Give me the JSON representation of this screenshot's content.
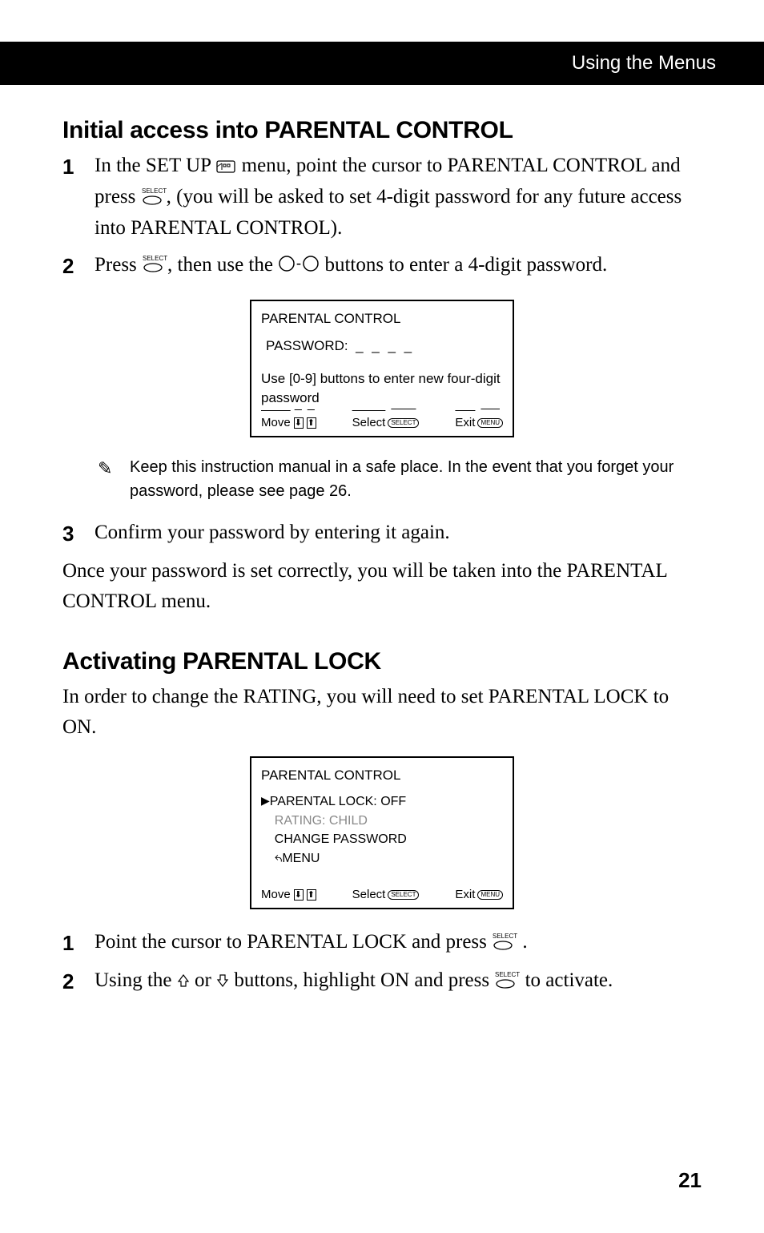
{
  "header": {
    "title": "Using the Menus"
  },
  "sections": {
    "initial": {
      "heading": "Initial access into PARENTAL CONTROL",
      "step1_num": "1",
      "step1_a": "In the SET UP ",
      "step1_b": " menu, point the cursor to PARENTAL CONTROL and press ",
      "step1_c": ", (you will be asked to set 4-digit password for any future access into PARENTAL CONTROL).",
      "step2_num": "2",
      "step2_a": "Press ",
      "step2_b": ", then use the ",
      "step2_c": " buttons to enter a 4-digit password."
    },
    "screenshot1": {
      "title": "PARENTAL CONTROL",
      "password_label": "PASSWORD:",
      "password_value": "_ _ _ _",
      "hint": "Use [0-9] buttons to enter new four-digit password",
      "move": "Move",
      "select": "Select",
      "exit": "Exit",
      "select_oval": "SELECT",
      "exit_oval": "MENU"
    },
    "note": {
      "text": "Keep this instruction manual in a safe place. In the event that you forget your password, please see page 26."
    },
    "post": {
      "step3_num": "3",
      "step3": "Confirm your password by entering it again.",
      "para": "Once your password is set correctly, you will be taken into the PARENTAL CONTROL menu."
    },
    "activating": {
      "heading": "Activating PARENTAL LOCK",
      "intro": "In order to change the RATING, you will need to set PARENTAL LOCK to ON.",
      "step1_num": "1",
      "step1_a": "Point the cursor to PARENTAL LOCK and press ",
      "step1_b": " .",
      "step2_num": "2",
      "step2_a": "Using the ",
      "step2_b": " or ",
      "step2_c": " buttons, highlight ON and press ",
      "step2_d": " to activate."
    },
    "screenshot2": {
      "title": "PARENTAL CONTROL",
      "item1": "PARENTAL LOCK: OFF",
      "item2": "RATING: CHILD",
      "item3": "CHANGE PASSWORD",
      "item4": "MENU",
      "move": "Move",
      "select": "Select",
      "exit": "Exit",
      "select_oval": "SELECT",
      "exit_oval": "MENU"
    },
    "icons": {
      "select_label": "SELECT",
      "circle_sep": "-"
    }
  },
  "page_number": "21"
}
